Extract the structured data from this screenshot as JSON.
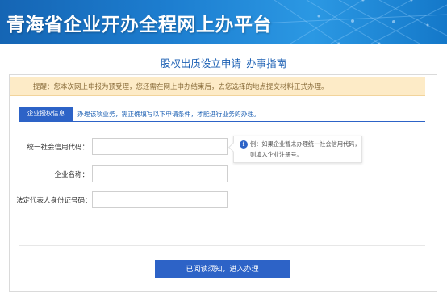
{
  "banner": {
    "title": "青海省企业开办全程网上办平台"
  },
  "page": {
    "heading": "股权出质设立申请_办事指南"
  },
  "notice": {
    "text": "提醒：您本次网上申报为预受理，您还需在网上申办结束后，去您选择的地点提交材料正式办理。"
  },
  "tabs": {
    "active_label": "企业授权信息",
    "instruction": "办理该项业务，需正确填写以下申请条件，才能进行业务的办理。"
  },
  "form": {
    "fields": [
      {
        "label": "统一社会信用代码：",
        "value": "",
        "placeholder": ""
      },
      {
        "label": "企业名称：",
        "value": "",
        "placeholder": ""
      },
      {
        "label": "法定代表人身份证号码：",
        "value": "",
        "placeholder": ""
      }
    ],
    "tip": {
      "icon": "info-icon",
      "line1": "例：如果企业暂未办理统一社会信用代码，",
      "line2": "则填入企业注册号。"
    }
  },
  "actions": {
    "submit_label": "已阅读须知，进入办理"
  },
  "colors": {
    "accent": "#2d63c7",
    "heading": "#1b5fb3",
    "notice_bg": "#fdebc7",
    "notice_text": "#8a6d3b"
  }
}
